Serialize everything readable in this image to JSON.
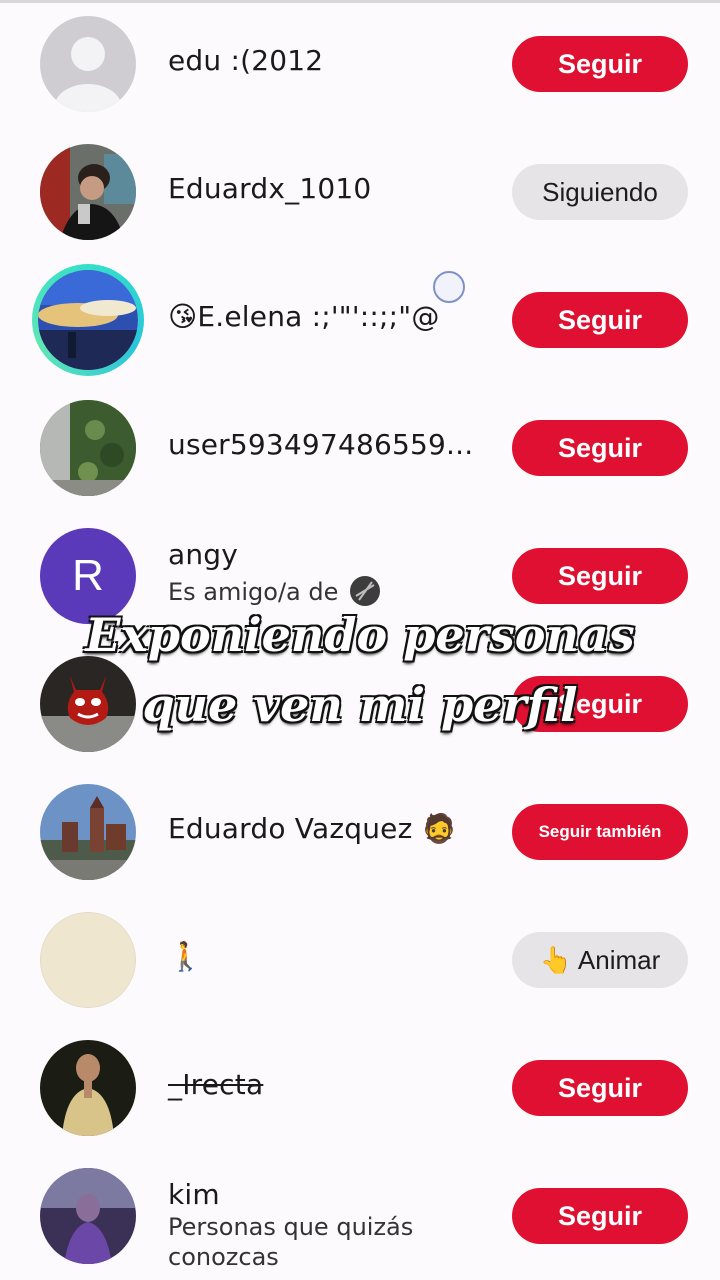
{
  "overlay_caption": {
    "line1": "Exponiendo personas",
    "line2": "que ven mi perfil"
  },
  "users": [
    {
      "name": "edu :(2012",
      "button": "Seguir",
      "button_style": "red"
    },
    {
      "name": "Eduardx_1010",
      "button": "Siguiendo",
      "button_style": "grey"
    },
    {
      "name": "😘E.elena :;'\"'::;;\"@",
      "button": "Seguir",
      "button_style": "red"
    },
    {
      "name": "user593497486559...",
      "button": "Seguir",
      "button_style": "red"
    },
    {
      "name": "angy",
      "subtitle": "Es amigo/a de",
      "button": "Seguir",
      "button_style": "red",
      "avatar_letter": "R"
    },
    {
      "name": "",
      "button": "Seguir",
      "button_style": "red"
    },
    {
      "name": "Eduardo Vazquez 🧔",
      "button": "Seguir también",
      "button_style": "red"
    },
    {
      "name": "🚶",
      "button": "👆 Animar",
      "button_style": "grey"
    },
    {
      "name": "_Irecta",
      "button": "Seguir",
      "button_style": "red"
    },
    {
      "name": "kim",
      "subtitle_line1": "Personas que quizás",
      "subtitle_line2": "conozcas",
      "button": "Seguir",
      "button_style": "red"
    }
  ],
  "colors": {
    "follow_red": "#df1031",
    "following_grey": "#e7e4e8",
    "story_ring": "#33e0c8"
  }
}
